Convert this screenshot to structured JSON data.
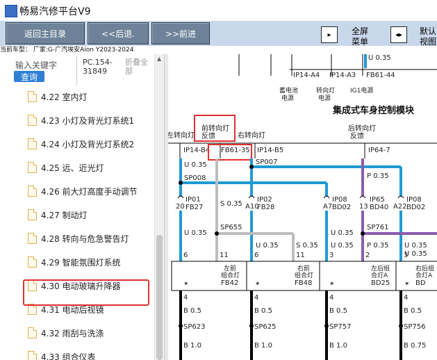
{
  "window": {
    "title": "畅易汽修平台V9"
  },
  "toolbar": {
    "home_label": "返回主目录",
    "back_label": "<<后退.",
    "forward_label": ">>前进",
    "fullscreen_label_1": "全屏",
    "fullscreen_label_2": "菜单",
    "default_label_1": "默认",
    "default_label_2": "视图"
  },
  "vehicle_info": "当前车型： 厂家:G-广汽埃安Aion Y2023-2024",
  "search": {
    "keyword_label": "输入关键字",
    "query_label": "查询",
    "pc_code": "PC.154-31849",
    "collapse_label": "折叠全部"
  },
  "tree": {
    "items": [
      {
        "label": "4.22 室内灯"
      },
      {
        "label": "4.23 小灯及背光灯系统1"
      },
      {
        "label": "4.24 小灯及背光灯系统2"
      },
      {
        "label": "4.25 远、近光灯"
      },
      {
        "label": "4.26 前大灯高度手动调节"
      },
      {
        "label": "4.27 制动灯"
      },
      {
        "label": "4.28 转向与危急警告灯"
      },
      {
        "label": "4.29 智能氛围灯系统"
      },
      {
        "label": "4.30 电动玻璃升降器"
      },
      {
        "label": "4.31 电动后视镜"
      },
      {
        "label": "4.32 雨刮与洗涤"
      },
      {
        "label": "4.33 组合仪表"
      }
    ],
    "selected_index": 6
  },
  "diagram": {
    "title": "集成式车身控制模块",
    "top_wire": "U 0.35",
    "top_conn": [
      "IP14-A4",
      "IP14-A3",
      "FB61-44"
    ],
    "top_labels": [
      "蓄电池",
      "电源",
      "转向灯",
      "电源",
      "IG1电源"
    ],
    "signals": [
      "左转向灯",
      "前转向灯",
      "反馈",
      "右转向灯",
      "后转向灯",
      "反馈"
    ],
    "module_pins": [
      "IP14-B4",
      "FB61-35",
      "IP14-B5",
      "IP64-7"
    ],
    "wires": [
      "U 0.35",
      "SP007",
      "SP008",
      "P 0.35",
      "S 0.35",
      "U 0.35",
      "U 0.35",
      "U 0.35",
      "SP655",
      "SP761",
      "U 0.35",
      "S 0.35",
      "U 0.35",
      "P 0.35",
      "U 0.35"
    ],
    "plugs": [
      {
        "pin": "20",
        "conn": "IP01",
        "sub": "FB27"
      },
      {
        "pin": "A10",
        "conn": "IP02",
        "sub": "FB28"
      },
      {
        "pin": "A7",
        "conn": "IP08",
        "sub": "BD02"
      },
      {
        "pin": "13",
        "conn": "IP65",
        "sub": "BD40"
      },
      {
        "pin": "A22",
        "conn": "IP08",
        "sub": "BD02"
      }
    ],
    "box_pins": [
      "6",
      "11",
      "6",
      "11",
      "3",
      "2",
      "3"
    ],
    "boxes": [
      {
        "l1": "左前",
        "l2": "组合灯",
        "l3": "FB42"
      },
      {
        "l1": "右前",
        "l2": "组合灯",
        "l3": "FB48"
      },
      {
        "l1": "左后组",
        "l2": "合灯A",
        "l3": "BD25"
      },
      {
        "l1": "右后组",
        "l2": "合灯A",
        "l3": "BD"
      }
    ],
    "ground_pins": [
      "4",
      "4",
      "4",
      "4"
    ],
    "ground_wires": [
      "B 0.5",
      "B 0.5",
      "B 0.5",
      "B 0.5"
    ],
    "splices": [
      "SP623",
      "SP625",
      "SP757",
      "SP756"
    ],
    "final_wires": [
      "B 1.0",
      "B 1.0",
      "B 1.0",
      "B 0.75"
    ]
  }
}
